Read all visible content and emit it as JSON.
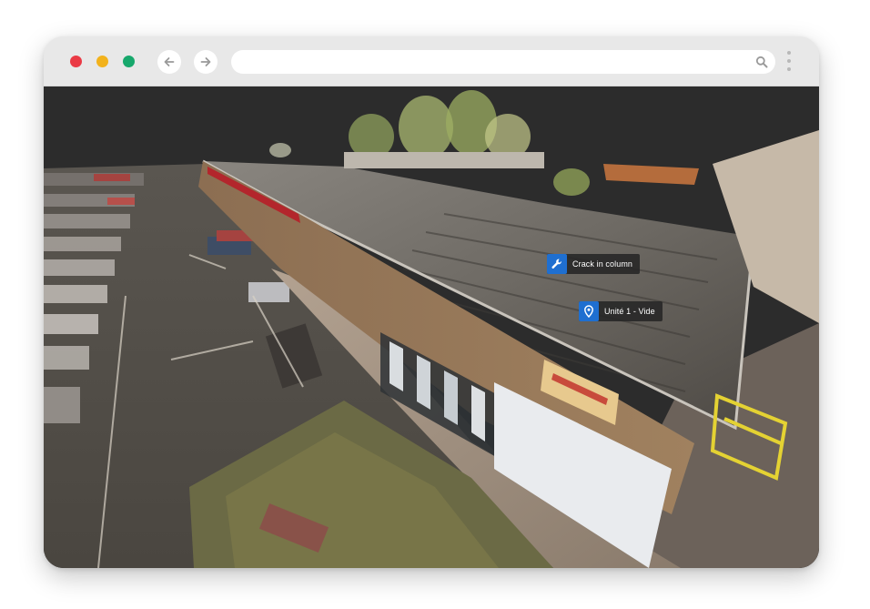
{
  "browser": {
    "url_value": "",
    "url_placeholder": "",
    "back_icon": "arrow-left-icon",
    "forward_icon": "arrow-right-icon",
    "search_icon": "search-icon",
    "menu_icon": "kebab-menu-icon",
    "traffic_lights": [
      "#ea3a45",
      "#f2b21c",
      "#17a86c"
    ]
  },
  "viewer": {
    "background_color": "#2c2c2c",
    "annotations": [
      {
        "label": "Crack in column",
        "icon": "wrench-icon",
        "icon_color": "#1f6fd0"
      },
      {
        "label": "Unité 1 - Vide",
        "icon": "map-pin-icon",
        "icon_color": "#1f6fd0"
      }
    ]
  }
}
